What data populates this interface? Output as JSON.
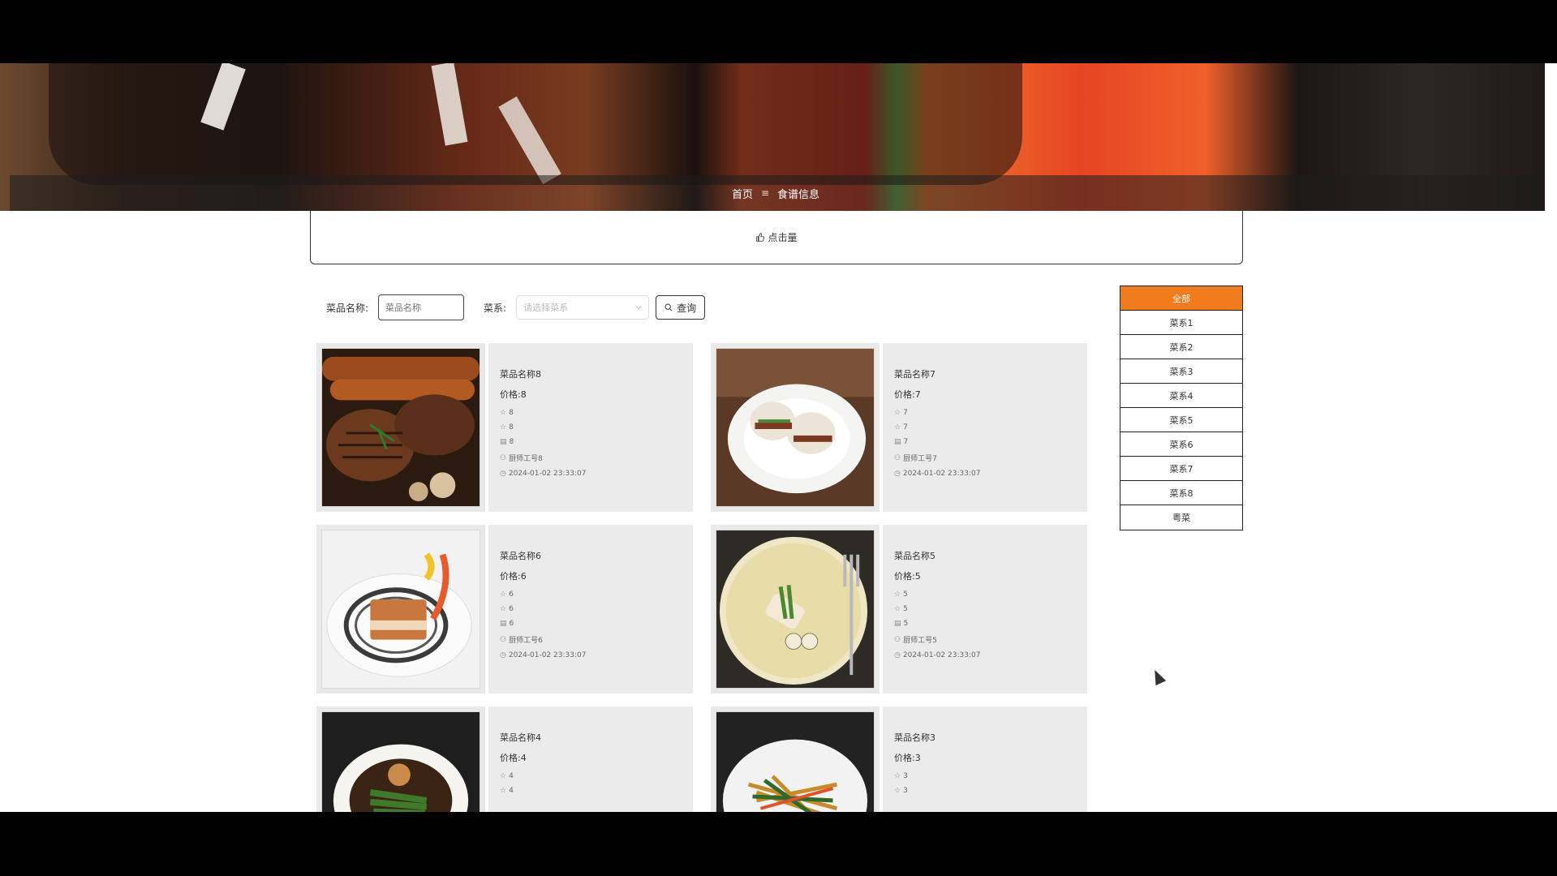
{
  "breadcrumb": {
    "home": "首页",
    "separator": "≡",
    "current": "食谱信息"
  },
  "stat": {
    "icon": "thumbs-up-icon",
    "label": "点击量"
  },
  "search": {
    "name_label": "菜品名称:",
    "name_placeholder": "菜品名称",
    "category_label": "菜系:",
    "category_placeholder": "请选择菜系",
    "button_label": "查询"
  },
  "cards": [
    {
      "name": "菜品名称8",
      "price": "价格:8",
      "stat1": "8",
      "stat2": "8",
      "stat3": "8",
      "chef": "厨师工号8",
      "date": "2024-01-02 23:33:07"
    },
    {
      "name": "菜品名称7",
      "price": "价格:7",
      "stat1": "7",
      "stat2": "7",
      "stat3": "7",
      "chef": "厨师工号7",
      "date": "2024-01-02 23:33:07"
    },
    {
      "name": "菜品名称6",
      "price": "价格:6",
      "stat1": "6",
      "stat2": "6",
      "stat3": "6",
      "chef": "厨师工号6",
      "date": "2024-01-02 23:33:07"
    },
    {
      "name": "菜品名称5",
      "price": "价格:5",
      "stat1": "5",
      "stat2": "5",
      "stat3": "5",
      "chef": "厨师工号5",
      "date": "2024-01-02 23:33:07"
    },
    {
      "name": "菜品名称4",
      "price": "价格:4",
      "stat1": "4",
      "stat2": "4",
      "stat3": "",
      "chef": "",
      "date": ""
    },
    {
      "name": "菜品名称3",
      "price": "价格:3",
      "stat1": "3",
      "stat2": "3",
      "stat3": "",
      "chef": "",
      "date": ""
    }
  ],
  "sidebar": {
    "items": [
      "全部",
      "菜系1",
      "菜系2",
      "菜系3",
      "菜系4",
      "菜系5",
      "菜系6",
      "菜系7",
      "菜系8",
      "粤菜"
    ],
    "active_color": "#f07c1e"
  }
}
